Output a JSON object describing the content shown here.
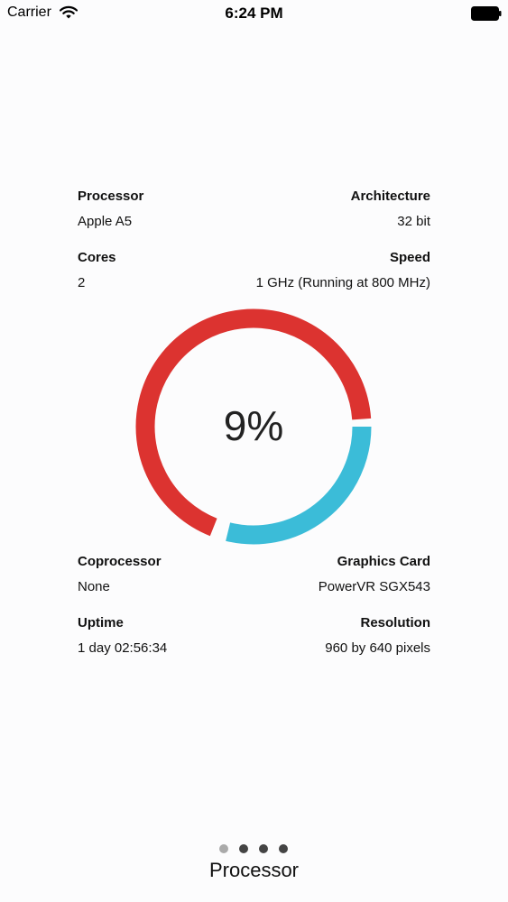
{
  "status_bar": {
    "carrier": "Carrier",
    "time": "6:24 PM"
  },
  "info_top": {
    "processor_label": "Processor",
    "processor_value": "Apple A5",
    "architecture_label": "Architecture",
    "architecture_value": "32 bit",
    "cores_label": "Cores",
    "cores_value": "2",
    "speed_label": "Speed",
    "speed_value": "1 GHz (Running at 800 MHz)"
  },
  "gauge": {
    "value_text": "9%",
    "usage_fraction": 0.09,
    "colors": {
      "used": "#3bbcd8",
      "free": "#dc3330"
    }
  },
  "info_bottom": {
    "coprocessor_label": "Coprocessor",
    "coprocessor_value": "None",
    "graphics_label": "Graphics Card",
    "graphics_value": "PowerVR SGX543",
    "uptime_label": "Uptime",
    "uptime_value": "1 day 02:56:34",
    "resolution_label": "Resolution",
    "resolution_value": "960 by 640 pixels"
  },
  "pager": {
    "page_count": 4,
    "current_index": 0,
    "title": "Processor"
  },
  "icons": [
    "wifi-icon",
    "battery-icon"
  ]
}
